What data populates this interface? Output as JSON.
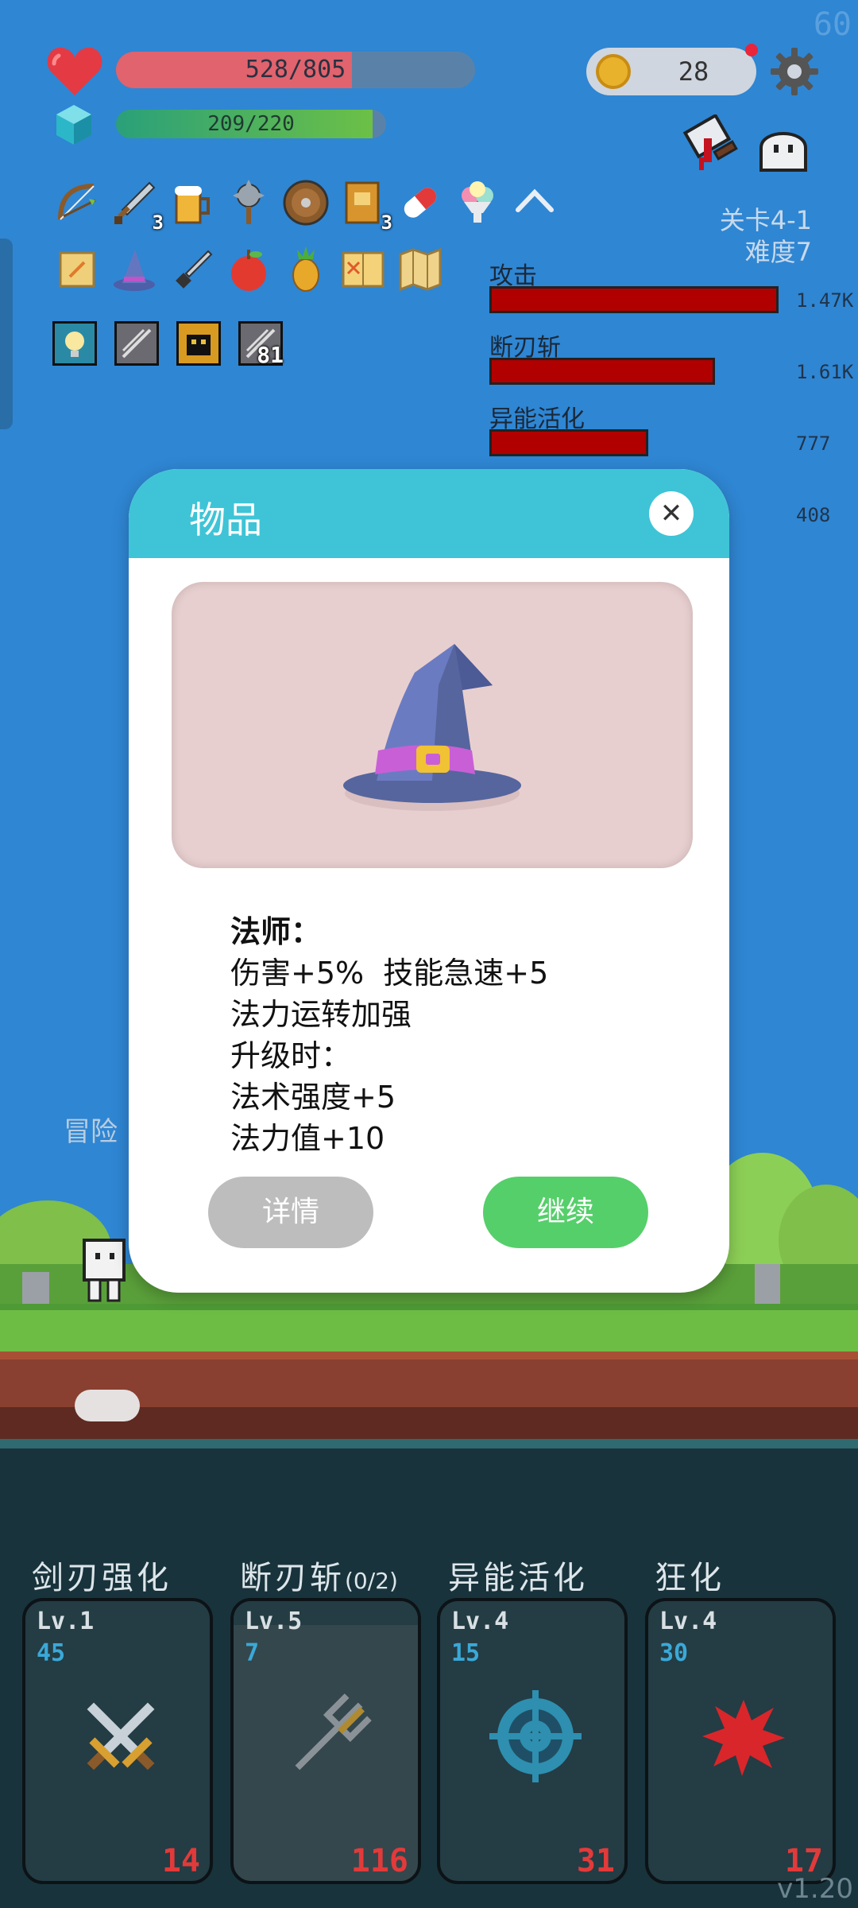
{
  "fps": "60",
  "hud": {
    "hp_text": "528/805",
    "hp_fraction": 0.656,
    "mp_text": "209/220",
    "mp_fraction": 0.95,
    "coins": "28",
    "stage": "关卡4-1",
    "difficulty": "难度7"
  },
  "damage": [
    {
      "label": "攻击",
      "value": "1.47K",
      "fraction": 1.0
    },
    {
      "label": "断刃斩",
      "value": "1.61K",
      "fraction": 0.78
    },
    {
      "label": "异能活化",
      "value": "777",
      "fraction": 0.55
    },
    {
      "label": "",
      "value": "408",
      "fraction": 0
    }
  ],
  "items_row1": [
    {
      "icon": "bow-icon"
    },
    {
      "icon": "sword-icon",
      "count": "3"
    },
    {
      "icon": "beer-mug-icon"
    },
    {
      "icon": "mace-icon"
    },
    {
      "icon": "round-shield-icon"
    },
    {
      "icon": "book-icon",
      "count": "3"
    },
    {
      "icon": "pill-icon"
    },
    {
      "icon": "ice-cream-icon"
    },
    {
      "icon": "chevron-up-icon"
    }
  ],
  "items_row2": [
    {
      "icon": "scroll-icon"
    },
    {
      "icon": "wizard-hat-icon"
    },
    {
      "icon": "dagger-icon"
    },
    {
      "icon": "apple-icon"
    },
    {
      "icon": "pineapple-icon"
    },
    {
      "icon": "recipe-book-icon"
    },
    {
      "icon": "map-icon"
    }
  ],
  "buffs": [
    {
      "icon": "lightbulb-buff-icon"
    },
    {
      "icon": "slash-buff-icon"
    },
    {
      "icon": "monster-buff-icon"
    },
    {
      "icon": "slash-buff-icon",
      "count": "81"
    }
  ],
  "scene": {
    "adventure_text": "冒险"
  },
  "dialog": {
    "title": "物品",
    "close_label": "✕",
    "item_name": "法师：",
    "lines": [
      "伤害+5%  技能急速+5",
      "法力运转加强",
      "升级时：",
      "法术强度+5",
      "法力值+10"
    ],
    "detail_label": "详情",
    "continue_label": "继续"
  },
  "skills": [
    {
      "title": "剑刃强化",
      "sub": "",
      "level": "Lv.1",
      "cost": "45",
      "count": "14",
      "icon": "crossed-swords-icon"
    },
    {
      "title": "断刃斩",
      "sub": "(0/2)",
      "level": "Lv.5",
      "cost": "7",
      "count": "116",
      "icon": "trident-icon"
    },
    {
      "title": "异能活化",
      "sub": "",
      "level": "Lv.4",
      "cost": "15",
      "count": "31",
      "icon": "target-icon"
    },
    {
      "title": "狂化",
      "sub": "",
      "level": "Lv.4",
      "cost": "30",
      "count": "17",
      "icon": "blood-splat-icon"
    }
  ],
  "version": "v1.20",
  "colors": {
    "accent": "#3ec4d6",
    "continue": "#55cf6a",
    "detail": "#bdbdbd",
    "damage_bar": "#b00000"
  }
}
